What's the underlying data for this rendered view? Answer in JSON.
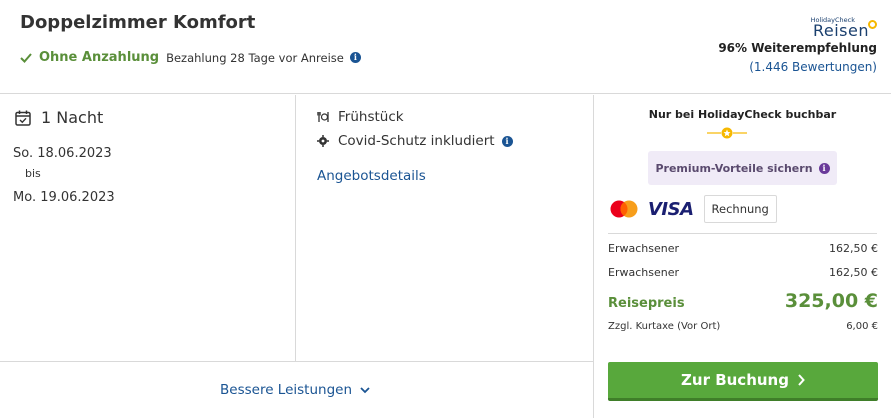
{
  "offer": {
    "title": "Doppelzimmer Komfort",
    "deposit_label": "Ohne Anzahlung",
    "payment_note": "Bezahlung 28 Tage vor Anreise"
  },
  "brand": {
    "small_text": "HolidayCheck",
    "big_text": "Reisen",
    "recommendation": "96% Weiterempfehlung",
    "reviews": "(1.446 Bewertungen)",
    "color": "#1a3f6e",
    "sun_color": "#f6b800"
  },
  "stay": {
    "nights": "1 Nacht",
    "from": "So. 18.06.2023",
    "separator": "bis",
    "to": "Mo. 19.06.2023"
  },
  "features": [
    {
      "icon": "meal-icon",
      "label": "Frühstück"
    },
    {
      "icon": "shield-icon",
      "label": "Covid-Schutz inkludiert"
    }
  ],
  "offer_details_link": "Angebotsdetails",
  "better_services": "Bessere Leistungen",
  "booking": {
    "exclusive": "Nur bei HolidayCheck buchbar",
    "premium": "Premium-Vorteile sichern",
    "payment_methods": [
      "Mastercard",
      "VISA"
    ],
    "invoice": "Rechnung",
    "price_lines": [
      {
        "label": "Erwachsener",
        "value": "162,50 €"
      },
      {
        "label": "Erwachsener",
        "value": "162,50 €"
      }
    ],
    "total_label": "Reisepreis",
    "total_value": "325,00 €",
    "tax_label": "Zzgl. Kurtaxe (Vor Ort)",
    "tax_value": "6,00 €",
    "book_button": "Zur Buchung"
  },
  "colors": {
    "accent_green": "#5a8f3a",
    "button_green": "#58a83c",
    "link_blue": "#1a5493",
    "premium_bg": "#f0ebf7"
  }
}
